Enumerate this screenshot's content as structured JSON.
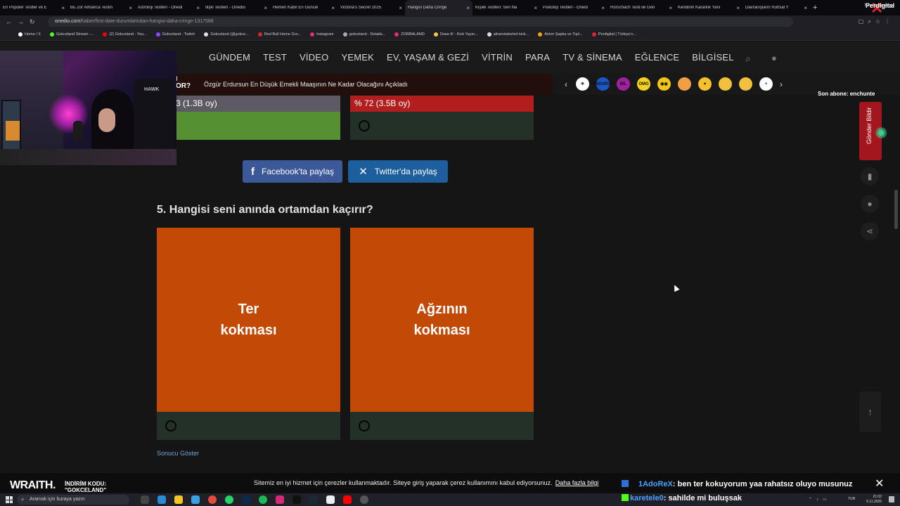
{
  "browser": {
    "tabs": [
      "En Popüler Testler ve E",
      "Bu Zor Almanca Testin",
      "Astroloji Testleri - Onedi",
      "İlişki Testleri - Onedio",
      "Hemen Kabıl En Güncel",
      "Victoria's Secret 2025",
      "Hangisi Daha Cringe",
      "Kişilik Testleri: Sen Na",
      "Psikoloji Testleri - Onedi",
      "Rorschach Testi ile Gen",
      "Kendinin Karanlık Yanı",
      "Davranışların Ruhsal Y"
    ],
    "active_tab_index": 6,
    "url_host": "onedio.com",
    "url_path": "/haber/first-date-durumlarindan-hangisi-daha-cringe-1317588",
    "brand_badge": "Perdigital",
    "bookmarks": [
      {
        "label": "Home / X",
        "color": "#ffffff"
      },
      {
        "label": "Gokceland Stream -...",
        "color": "#53fc18"
      },
      {
        "label": "(2) Gokceland - You...",
        "color": "#ff0000"
      },
      {
        "label": "Gokceland - Twitch",
        "color": "#9146ff"
      },
      {
        "label": "Gokceland (@gokce...",
        "color": "#e0e0e0"
      },
      {
        "label": "Red Bull Home Gro...",
        "color": "#d62a2a"
      },
      {
        "label": "Instagram",
        "color": "#e1306c"
      },
      {
        "label": "gokceland - Detaile...",
        "color": "#aaaaaa"
      },
      {
        "label": "ZORBALAND",
        "color": "#e1306c"
      },
      {
        "label": "Draw It! - Kick Yayın...",
        "color": "#f2c744"
      },
      {
        "label": "aitranslatorbot kick...",
        "color": "#dddddd"
      },
      {
        "label": "Atılım Şapka ve Tişö...",
        "color": "#f0a500"
      },
      {
        "label": "Perdigital | Türkiye'n...",
        "color": "#e0242f"
      }
    ],
    "all_bookmarks_label": "Tüm Yer İşaretleri"
  },
  "site": {
    "nav": [
      "GÜNDEM",
      "TEST",
      "VİDEO",
      "YEMEK",
      "EV, YAŞAM & GEZİ",
      "VİTRİN",
      "PARA",
      "TV & SİNEMA",
      "EĞLENCE",
      "BİLGİSEL"
    ],
    "ticker_tag": "OR?",
    "ticker_prefix": "l",
    "ticker_headline": "Özgür Erdursun En Düşük Emekli Maaşının Ne Kadar Olacağını Açıkladı",
    "emojis": [
      {
        "label": "✳",
        "color": "#ffffff"
      },
      {
        "label": "PINDURUM",
        "color": "#1c57c7"
      },
      {
        "label": "BİL",
        "color": "#a020a0"
      },
      {
        "label": "OMG",
        "color": "#f3d31b"
      },
      {
        "label": "◉◉",
        "color": "#f0c419"
      },
      {
        "label": "",
        "color": "#f0a040"
      },
      {
        "label": "♥",
        "color": "#f6c12c"
      },
      {
        "label": "",
        "color": "#f2c03d"
      },
      {
        "label": "",
        "color": "#f2c03d"
      },
      {
        "label": "+",
        "color": "#ffffff"
      }
    ]
  },
  "previous_question": {
    "left_result": "3 (1.3B oy)",
    "right_result": "% 72 (3.5B oy)",
    "left_bar_color": "#5e5a63",
    "right_bar_color": "#b21e1e",
    "left_fill_color": "#559032",
    "right_fill_color": "#243128"
  },
  "share": {
    "facebook": "Facebook'ta paylaş",
    "twitter": "Twitter'da paylaş"
  },
  "question": {
    "title": "5. Hangisi seni anında ortamdan kaçırır?",
    "options": [
      {
        "line1": "Ter",
        "line2": "kokması"
      },
      {
        "line1": "Ağzının",
        "line2": "kokması"
      }
    ],
    "card_color": "#c34a06",
    "show_result": "Sonucu Göster"
  },
  "side": {
    "sub_note": "Son abone: enchunte",
    "tab_label": "Gönder Bildir"
  },
  "stream": {
    "wraith": "WRAITH.",
    "promo_line1": "İNDİRİM KODU:",
    "promo_line2": "\"GOKCELAND\"",
    "chat": [
      {
        "user": "1AdoReX",
        "text": ": ben ter kokuyorum yaa rahatsız oluyo musunuz"
      },
      {
        "user": "karetele0",
        "text": ": sahilde mi buluşsak"
      }
    ]
  },
  "cookie": {
    "text": "Sitemiz en iyi hizmet için çerezler kullanmaktadır. Siteye giriş yaparak çerez kullanımını kabul ediyorsunuz.",
    "link": "Daha fazla bilgi"
  },
  "taskbar": {
    "search_placeholder": "Aramak için buraya yazın",
    "time": "21:02",
    "date": "6.11.2025",
    "lang": "TUR"
  }
}
